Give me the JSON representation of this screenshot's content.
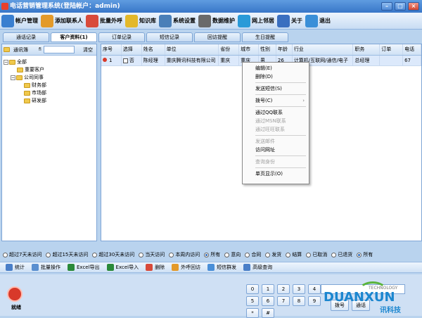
{
  "window": {
    "title": "电话营销管理系统(登陆帐户：admin)",
    "min": "–",
    "max": "□",
    "close": "×"
  },
  "toolbar": [
    {
      "label": "帐户管理",
      "icon": "account-icon",
      "color": "#3a7fd0"
    },
    {
      "label": "添加联系人",
      "icon": "add-contact-icon",
      "color": "#e39a2a"
    },
    {
      "label": "批量外呼",
      "icon": "batch-call-icon",
      "color": "#d84a3a"
    },
    {
      "label": "知识库",
      "icon": "knowledge-icon",
      "color": "#e3b82a"
    },
    {
      "label": "系统设置",
      "icon": "settings-icon",
      "color": "#4a7fb8"
    },
    {
      "label": "数据维护",
      "icon": "database-icon",
      "color": "#6a6a6a"
    },
    {
      "label": "网上邻居",
      "icon": "network-icon",
      "color": "#2a9ad8"
    },
    {
      "label": "关于",
      "icon": "about-icon",
      "color": "#3a6fc0"
    },
    {
      "label": "退出",
      "icon": "exit-icon",
      "color": "#3a8fd8"
    }
  ],
  "tabs": [
    "通话记录",
    "客户资料(1)",
    "订单记录",
    "短信记录",
    "回访提醒",
    "生日提醒"
  ],
  "left": {
    "header": "通讯簿",
    "filter_glyph": "fi",
    "clear": "清空",
    "tree": [
      {
        "label": "全部",
        "level": 0,
        "expander": "−"
      },
      {
        "label": "重要客户",
        "level": 1,
        "expander": ""
      },
      {
        "label": "公司同事",
        "level": 1,
        "expander": "−"
      },
      {
        "label": "财务部",
        "level": 2,
        "expander": ""
      },
      {
        "label": "市场部",
        "level": 2,
        "expander": ""
      },
      {
        "label": "研发部",
        "level": 2,
        "expander": ""
      }
    ]
  },
  "grid": {
    "columns": [
      "序号",
      "选择",
      "姓名",
      "单位",
      "省份",
      "城市",
      "性别",
      "年龄",
      "行业",
      "职务",
      "订单",
      "电话"
    ],
    "rows": [
      [
        "1",
        "否",
        "陈经理",
        "重庆腾讯科技有限公司",
        "重庆",
        "重庆",
        "男",
        "26",
        "计算机/互联网/通信/电子",
        "总经理",
        "",
        "67"
      ]
    ]
  },
  "context_menu": [
    {
      "label": "编辑(E)",
      "disabled": false
    },
    {
      "label": "删除(D)",
      "disabled": false
    },
    {
      "sep": true
    },
    {
      "label": "发送短信(S)",
      "disabled": false
    },
    {
      "sep": true
    },
    {
      "label": "拨号(C)",
      "disabled": false,
      "submenu": true
    },
    {
      "sep": true
    },
    {
      "label": "通过QQ联系",
      "disabled": false
    },
    {
      "label": "通过MSN联系",
      "disabled": true
    },
    {
      "label": "通过旺旺联系",
      "disabled": true
    },
    {
      "sep": true
    },
    {
      "label": "发送邮件",
      "disabled": true
    },
    {
      "label": "访问网址",
      "disabled": false
    },
    {
      "sep": true
    },
    {
      "label": "查询身份",
      "disabled": true
    },
    {
      "sep": true
    },
    {
      "label": "单页显示(O)",
      "disabled": false
    }
  ],
  "filters": [
    {
      "label": "超过7天未访问",
      "on": false
    },
    {
      "label": "超过15天未访问",
      "on": false
    },
    {
      "label": "超过30天未访问",
      "on": false
    },
    {
      "label": "当天访问",
      "on": false
    },
    {
      "label": "本周内访问",
      "on": false
    },
    {
      "label": "所有",
      "on": true
    },
    {
      "label": "意向",
      "on": false
    },
    {
      "label": "合同",
      "on": false
    },
    {
      "label": "发货",
      "on": false
    },
    {
      "label": "结算",
      "on": false
    },
    {
      "label": "已取消",
      "on": false
    },
    {
      "label": "已退货",
      "on": false
    },
    {
      "label": "所有",
      "on": true
    }
  ],
  "actions": [
    {
      "label": "统计",
      "icon": "stats-icon",
      "color": "#4a7fc8"
    },
    {
      "label": "批量操作",
      "icon": "batch-icon",
      "color": "#5a8fd0"
    },
    {
      "label": "Excel导出",
      "icon": "excel-export-icon",
      "color": "#2a8a3a"
    },
    {
      "label": "Excel导入",
      "icon": "excel-import-icon",
      "color": "#2a8a3a"
    },
    {
      "label": "删除",
      "icon": "delete-icon",
      "color": "#d84a3a"
    },
    {
      "label": "外呼回访",
      "icon": "callback-icon",
      "color": "#e39a2a"
    },
    {
      "label": "短信群发",
      "icon": "sms-icon",
      "color": "#4a8fd8"
    },
    {
      "label": "高级查询",
      "icon": "advanced-search-icon",
      "color": "#4a7fc8"
    }
  ],
  "status": {
    "phone_label": "就绪"
  },
  "keypad": [
    "0",
    "1",
    "2",
    "3",
    "4",
    "5",
    "6",
    "7",
    "8",
    "9",
    "*",
    "#"
  ],
  "dial": {
    "dial_btn": "拨号",
    "hangup_btn": "通话"
  },
  "brand": {
    "name": "DUANXUN",
    "sub": "TECHNOLOGY",
    "cn": "讯科技"
  }
}
